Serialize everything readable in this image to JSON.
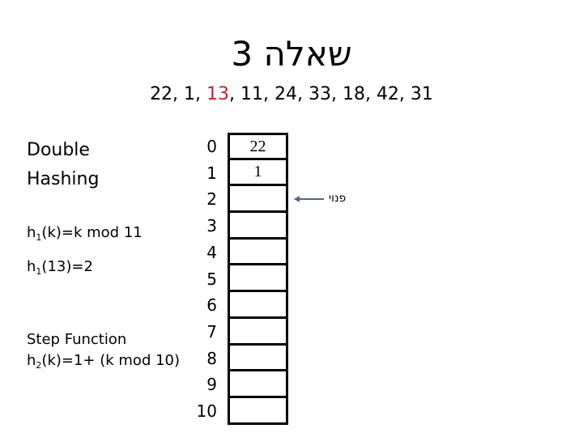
{
  "title": "שאלה 3",
  "sequence": {
    "before": "22, 1, ",
    "highlight": "13",
    "after": ", 11, 24, 33, 18, 42, 31",
    "highlight_color": "#c0262d"
  },
  "left": {
    "heading_line1": "Double",
    "heading_line2": "Hashing",
    "h1_def": {
      "prefix": "h",
      "sub": "1",
      "rest": "(k)=k mod 11"
    },
    "h1_val": {
      "prefix": "h",
      "sub": "1",
      "rest": "(13)=2"
    },
    "step_label": "Step Function",
    "h2_def": {
      "prefix": "h",
      "sub": "2",
      "rest": "(k)=1+ (k mod 10)"
    }
  },
  "table": {
    "indices": [
      "0",
      "1",
      "2",
      "3",
      "4",
      "5",
      "6",
      "7",
      "8",
      "9",
      "10"
    ],
    "cells": [
      "22",
      "1",
      "",
      "",
      "",
      "",
      "",
      "",
      "",
      "",
      ""
    ]
  },
  "annotation": {
    "label": "פנוי",
    "target_index": 2
  }
}
